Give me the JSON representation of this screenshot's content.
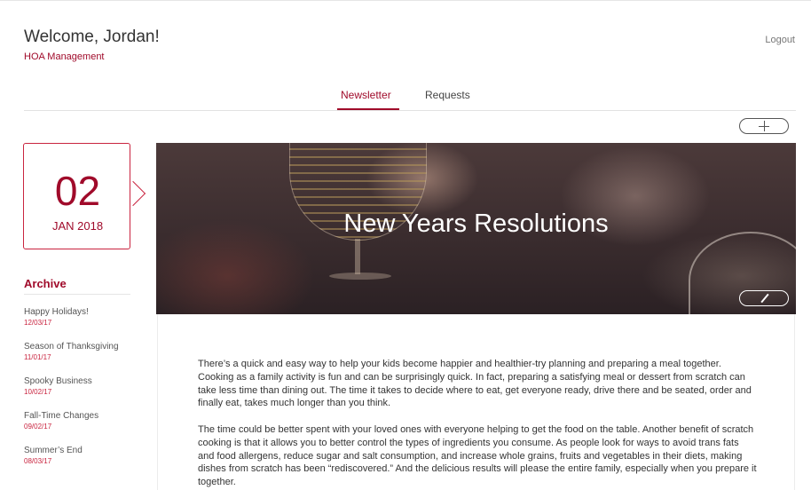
{
  "header": {
    "welcome": "Welcome, Jordan!",
    "company": "HOA Management",
    "logout": "Logout"
  },
  "tabs": [
    {
      "label": "Newsletter",
      "active": true
    },
    {
      "label": "Requests",
      "active": false
    }
  ],
  "current": {
    "day": "02",
    "month_year": "JAN 2018"
  },
  "archive": {
    "title": "Archive",
    "items": [
      {
        "name": "Happy Holidays!",
        "date": "12/03/17"
      },
      {
        "name": "Season of Thanksgiving",
        "date": "11/01/17"
      },
      {
        "name": "Spooky Business",
        "date": "10/02/17"
      },
      {
        "name": "Fall-Time Changes",
        "date": "09/02/17"
      },
      {
        "name": "Summer’s End",
        "date": "08/03/17"
      }
    ]
  },
  "newsletter": {
    "title": "New Years Resolutions",
    "paragraphs": [
      "There’s a quick and easy way to help your kids become happier and healthier-try planning and preparing a meal together. Cooking as a family activity is fun and can be surprisingly quick. In fact, preparing a satisfying meal or dessert from scratch can take less time than dining out. The time it takes to decide where to eat, get everyone ready, drive there and be seated, order and finally eat, takes much longer than you think.",
      "The time could be better spent with your loved ones with everyone helping to get the food on the table. Another benefit of scratch cooking is that it allows you to better control the types of ingredients you consume. As people look for ways to avoid trans fats and food allergens, reduce sugar and salt consumption, and increase whole grains, fruits and vegetables in their diets, making dishes from scratch has been “rediscovered.” And the delicious results will please the entire family, especially when you prepare it together."
    ]
  },
  "icons": {
    "add": "plus-icon",
    "edit": "pencil-icon"
  },
  "colors": {
    "accent": "#a00a2a",
    "accent_border": "#c9243f"
  }
}
